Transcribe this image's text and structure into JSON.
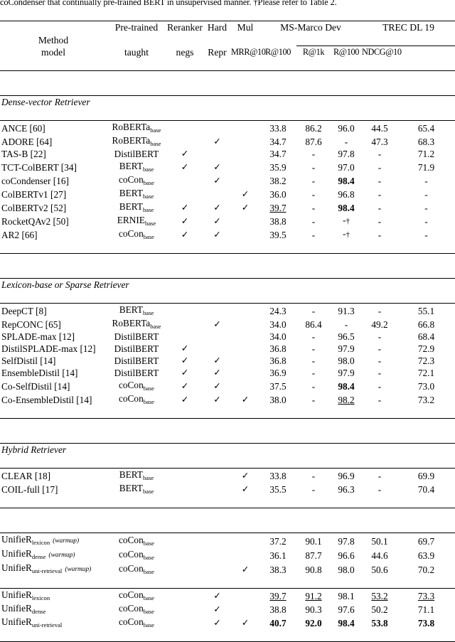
{
  "caption": "coCondenser that continually pre-trained BERT in unsupervised manner. †Please refer to Table 2.",
  "header": {
    "method": "Method",
    "pretrained_line1": "Pre-trained",
    "pretrained_line2": "model",
    "reranker_line1": "Reranker",
    "reranker_line2": "taught",
    "hardnegs_line1": "Hard",
    "hardnegs_line2": "negs",
    "mulrepr_line1": "Mul",
    "mulrepr_line2": "Repr",
    "group_msmarco": "MS-Marco Dev",
    "group_trec": "TREC DL 19",
    "col_mrr10": "MRR@10",
    "col_r100": "R@100",
    "col_r1k": "R@1k",
    "col_trec_r100": "R@100",
    "col_ndcg10": "NDCG@10"
  },
  "check_glyph": "✓",
  "dagger": "†",
  "dash": "-",
  "sections": [
    {
      "label": "Dense-vector Retriever",
      "rows": [
        {
          "name": "ANCE [60]",
          "pre": "RoBERTa",
          "pre_sub": "base",
          "rr": "",
          "hn": "",
          "mr": "",
          "mrr10": "33.8",
          "r100": "86.2",
          "r1k": "96.0",
          "trec_r100": "44.5",
          "ndcg10": "65.4"
        },
        {
          "name": "ADORE [64]",
          "pre": "RoBERTa",
          "pre_sub": "base",
          "rr": "",
          "hn": "✓",
          "mr": "",
          "mrr10": "34.7",
          "r100": "87.6",
          "r1k": "-",
          "trec_r100": "47.3",
          "ndcg10": "68.3"
        },
        {
          "name": "TAS-B [22]",
          "pre": "DistilBERT",
          "pre_sub": "",
          "rr": "✓",
          "hn": "",
          "mr": "",
          "mrr10": "34.7",
          "r100": "-",
          "r1k": "97.8",
          "trec_r100": "-",
          "ndcg10": "71.2"
        },
        {
          "name": "TCT-ColBERT [34]",
          "pre": "BERT",
          "pre_sub": "base",
          "rr": "✓",
          "hn": "✓",
          "mr": "",
          "mrr10": "35.9",
          "r100": "-",
          "r1k": "97.0",
          "trec_r100": "-",
          "ndcg10": "71.9"
        },
        {
          "name": "coCondenser [16]",
          "pre": "coCon",
          "pre_sub": "base",
          "rr": "",
          "hn": "✓",
          "mr": "",
          "mrr10": "38.2",
          "r100": "-",
          "r1k": "98.4",
          "r1k_style": "bold",
          "trec_r100": "-",
          "ndcg10": "-"
        },
        {
          "name": "ColBERTv1 [27]",
          "pre": "BERT",
          "pre_sub": "base",
          "rr": "",
          "hn": "",
          "mr": "✓",
          "mrr10": "36.0",
          "r100": "-",
          "r1k": "96.8",
          "trec_r100": "-",
          "ndcg10": "-"
        },
        {
          "name": "ColBERTv2 [52]",
          "pre": "BERT",
          "pre_sub": "base",
          "rr": "✓",
          "hn": "✓",
          "mr": "✓",
          "mrr10": "39.7",
          "mrr10_style": "und",
          "r100": "-",
          "r1k": "98.4",
          "r1k_style": "bold",
          "trec_r100": "-",
          "ndcg10": "-"
        },
        {
          "name": "RocketQAv2 [50]",
          "pre": "ERNIE",
          "pre_sub": "base",
          "rr": "✓",
          "hn": "✓",
          "mr": "",
          "mrr10": "38.8",
          "r100": "-",
          "r1k": "-†",
          "trec_r100": "-",
          "ndcg10": "-"
        },
        {
          "name": "AR2 [66]",
          "pre": "coCon",
          "pre_sub": "base",
          "rr": "✓",
          "hn": "✓",
          "mr": "",
          "mrr10": "39.5",
          "r100": "-",
          "r1k": "-†",
          "trec_r100": "-",
          "ndcg10": "-"
        }
      ]
    },
    {
      "label": "Lexicon-base or Sparse Retriever",
      "rows": [
        {
          "name": "DeepCT [8]",
          "pre": "BERT",
          "pre_sub": "base",
          "rr": "",
          "hn": "",
          "mr": "",
          "mrr10": "24.3",
          "r100": "-",
          "r1k": "91.3",
          "trec_r100": "-",
          "ndcg10": "55.1"
        },
        {
          "name": "RepCONC [65]",
          "pre": "RoBERTa",
          "pre_sub": "base",
          "rr": "",
          "hn": "✓",
          "mr": "",
          "mrr10": "34.0",
          "r100": "86.4",
          "r1k": "-",
          "trec_r100": "49.2",
          "ndcg10": "66.8"
        },
        {
          "name": "SPLADE-max [12]",
          "pre": "DistilBERT",
          "pre_sub": "",
          "rr": "",
          "hn": "",
          "mr": "",
          "mrr10": "34.0",
          "r100": "-",
          "r1k": "96.5",
          "trec_r100": "-",
          "ndcg10": "68.4"
        },
        {
          "name": "DistilSPLADE-max [12]",
          "pre": "DistilBERT",
          "pre_sub": "",
          "rr": "✓",
          "hn": "",
          "mr": "",
          "mrr10": "36.8",
          "r100": "-",
          "r1k": "97.9",
          "trec_r100": "-",
          "ndcg10": "72.9"
        },
        {
          "name": "SelfDistil [14]",
          "pre": "DistilBERT",
          "pre_sub": "",
          "rr": "✓",
          "hn": "✓",
          "mr": "",
          "mrr10": "36.8",
          "r100": "-",
          "r1k": "98.0",
          "trec_r100": "-",
          "ndcg10": "72.3"
        },
        {
          "name": "EnsembleDistil [14]",
          "pre": "DistilBERT",
          "pre_sub": "",
          "rr": "✓",
          "hn": "✓",
          "mr": "",
          "mrr10": "36.9",
          "r100": "-",
          "r1k": "97.9",
          "trec_r100": "-",
          "ndcg10": "72.1"
        },
        {
          "name": "Co-SelfDistil [14]",
          "pre": "coCon",
          "pre_sub": "base",
          "rr": "✓",
          "hn": "✓",
          "mr": "",
          "mrr10": "37.5",
          "r100": "-",
          "r1k": "98.4",
          "r1k_style": "bold",
          "trec_r100": "-",
          "ndcg10": "73.0"
        },
        {
          "name": "Co-EnsembleDistil [14]",
          "pre": "coCon",
          "pre_sub": "base",
          "rr": "✓",
          "hn": "✓",
          "mr": "✓",
          "mrr10": "38.0",
          "r100": "-",
          "r1k": "98.2",
          "r1k_style": "und",
          "trec_r100": "-",
          "ndcg10": "73.2"
        }
      ]
    },
    {
      "label": "Hybrid Retriever",
      "rows": [
        {
          "name": "CLEAR [18]",
          "pre": "BERT",
          "pre_sub": "base",
          "rr": "",
          "hn": "",
          "mr": "✓",
          "mrr10": "33.8",
          "r100": "-",
          "r1k": "96.9",
          "trec_r100": "-",
          "ndcg10": "69.9"
        },
        {
          "name": "COIL-full [17]",
          "pre": "BERT",
          "pre_sub": "base",
          "rr": "",
          "hn": "",
          "mr": "✓",
          "mrr10": "35.5",
          "r100": "-",
          "r1k": "96.3",
          "trec_r100": "-",
          "ndcg10": "70.4"
        }
      ]
    },
    {
      "label": "",
      "rows": [
        {
          "name": "UnifieR",
          "name_sub": "lexicon",
          "name_note": "(warmup)",
          "pre": "coCon",
          "pre_sub": "base",
          "rr": "",
          "hn": "",
          "mr": "",
          "mrr10": "37.2",
          "r100": "90.1",
          "r1k": "97.8",
          "trec_r100": "50.1",
          "ndcg10": "69.7"
        },
        {
          "name": "UnifieR",
          "name_sub": "dense",
          "name_note": "(warmup)",
          "pre": "coCon",
          "pre_sub": "base",
          "rr": "",
          "hn": "",
          "mr": "",
          "mrr10": "36.1",
          "r100": "87.7",
          "r1k": "96.6",
          "trec_r100": "44.6",
          "ndcg10": "63.9"
        },
        {
          "name": "UnifieR",
          "name_sub": "uni-retrieval",
          "name_note": "(warmup)",
          "pre": "coCon",
          "pre_sub": "base",
          "rr": "",
          "hn": "",
          "mr": "✓",
          "mrr10": "38.3",
          "r100": "90.8",
          "r1k": "98.0",
          "trec_r100": "50.6",
          "ndcg10": "70.2"
        }
      ]
    },
    {
      "label": "",
      "rows": [
        {
          "name": "UnifieR",
          "name_sub": "lexicon",
          "name_note": "",
          "pre": "coCon",
          "pre_sub": "base",
          "rr": "",
          "hn": "✓",
          "mr": "",
          "mrr10": "39.7",
          "mrr10_style": "und",
          "r100": "91.2",
          "r100_style": "und",
          "r1k": "98.1",
          "trec_r100": "53.2",
          "trec_r100_style": "und",
          "ndcg10": "73.3",
          "ndcg10_style": "und"
        },
        {
          "name": "UnifieR",
          "name_sub": "dense",
          "name_note": "",
          "pre": "coCon",
          "pre_sub": "base",
          "rr": "",
          "hn": "✓",
          "mr": "",
          "mrr10": "38.8",
          "r100": "90.3",
          "r1k": "97.6",
          "trec_r100": "50.2",
          "ndcg10": "71.1"
        },
        {
          "name": "UnifieR",
          "name_sub": "uni-retrieval",
          "name_note": "",
          "pre": "coCon",
          "pre_sub": "base",
          "rr": "",
          "hn": "✓",
          "mr": "✓",
          "mrr10": "40.7",
          "mrr10_style": "bold",
          "r100": "92.0",
          "r100_style": "bold",
          "r1k": "98.4",
          "r1k_style": "bold",
          "trec_r100": "53.8",
          "trec_r100_style": "bold",
          "ndcg10": "73.8",
          "ndcg10_style": "bold"
        }
      ]
    }
  ]
}
